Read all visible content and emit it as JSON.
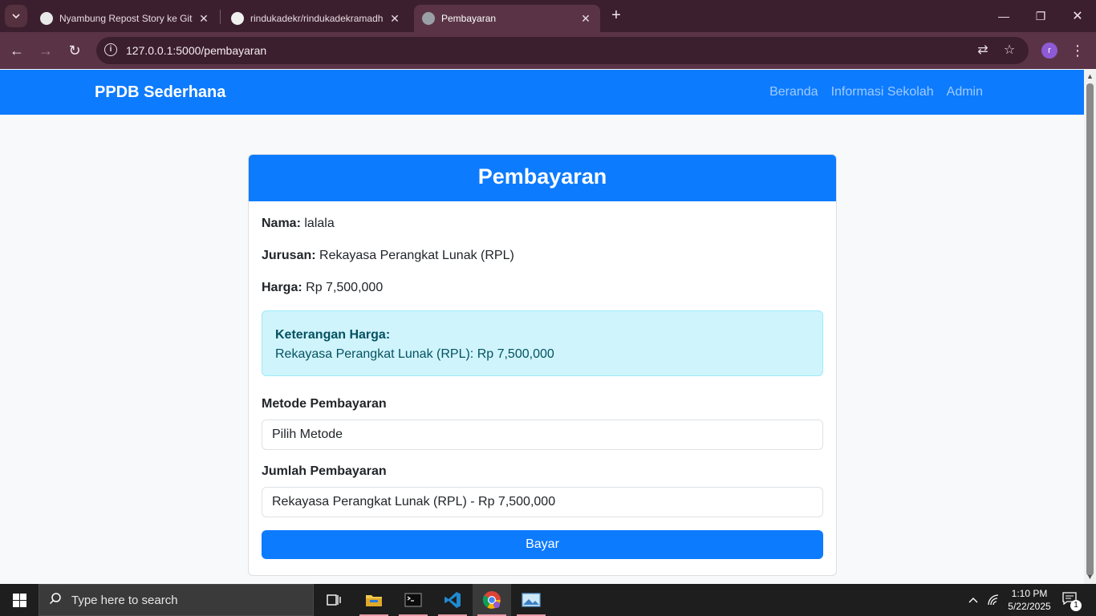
{
  "browser": {
    "tabs": [
      {
        "title": "Nyambung Repost Story ke Git",
        "active": false
      },
      {
        "title": "rindukadekr/rindukadekramadh",
        "active": false
      },
      {
        "title": "Pembayaran",
        "active": true
      }
    ],
    "url": "127.0.0.1:5000/pembayaran",
    "profile_initial": "r",
    "accent_color": "#5a3446"
  },
  "navbar": {
    "brand": "PPDB Sederhana",
    "links": [
      "Beranda",
      "Informasi Sekolah",
      "Admin"
    ],
    "color": "#0d7bfe"
  },
  "card": {
    "title": "Pembayaran",
    "nama_label": "Nama:",
    "nama_value": "lalala",
    "jurusan_label": "Jurusan:",
    "jurusan_value": "Rekayasa Perangkat Lunak (RPL)",
    "harga_label": "Harga:",
    "harga_value": "Rp 7,500,000",
    "alert_title": "Keterangan Harga:",
    "alert_text": "Rekayasa Perangkat Lunak (RPL): Rp 7,500,000",
    "metode_label": "Metode Pembayaran",
    "metode_value": "Pilih Metode",
    "jumlah_label": "Jumlah Pembayaran",
    "jumlah_value": "Rekayasa Perangkat Lunak (RPL) - Rp 7,500,000",
    "submit_label": "Bayar"
  },
  "taskbar": {
    "search_placeholder": "Type here to search",
    "time": "1:10 PM",
    "date": "5/22/2025",
    "notification_count": "1"
  }
}
